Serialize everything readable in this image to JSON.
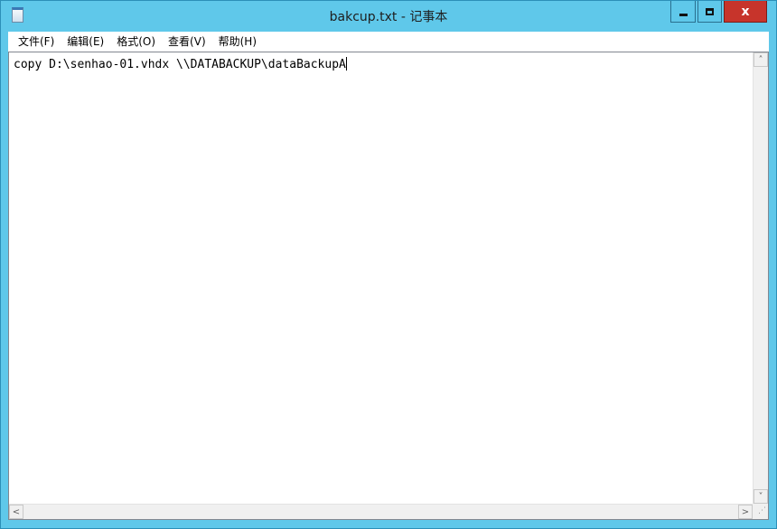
{
  "window": {
    "title": "bakcup.txt - 记事本",
    "app_icon": "notepad-icon",
    "controls": {
      "minimize_icon": "minimize-icon",
      "maximize_icon": "maximize-icon",
      "close_label": "x"
    },
    "accent_color": "#5fc8ea",
    "close_color": "#c7342b"
  },
  "menu": {
    "items": [
      {
        "label": "文件(F)"
      },
      {
        "label": "编辑(E)"
      },
      {
        "label": "格式(O)"
      },
      {
        "label": "查看(V)"
      },
      {
        "label": "帮助(H)"
      }
    ]
  },
  "editor": {
    "content": "copy D:\\senhao-01.vhdx \\\\DATABACKUP\\dataBackupA"
  },
  "scrollbars": {
    "up_glyph": "˄",
    "down_glyph": "˅",
    "left_glyph": "<",
    "right_glyph": ">",
    "grip_glyph": "⋰"
  }
}
